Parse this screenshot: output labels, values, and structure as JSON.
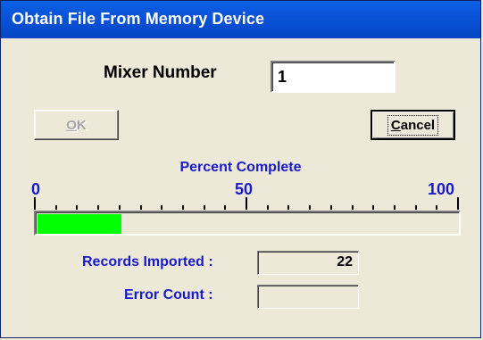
{
  "window": {
    "title": "Obtain File From  Memory Device"
  },
  "mixer": {
    "label": "Mixer Number",
    "value": "1"
  },
  "buttons": {
    "ok_letter": "O",
    "ok_rest": "K",
    "cancel_letter": "C",
    "cancel_rest": "ancel"
  },
  "progress": {
    "label": "Percent Complete",
    "scale_min": "0",
    "scale_mid": "50",
    "scale_max": "100",
    "percent": 20,
    "fill_color": "#00ff00",
    "label_color": "#1a1ac8"
  },
  "records": {
    "label": "Records Imported :",
    "value": "22"
  },
  "errors": {
    "label": "Error Count :",
    "value": ""
  }
}
